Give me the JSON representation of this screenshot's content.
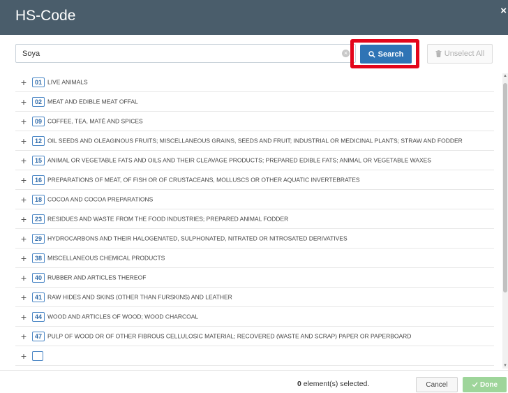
{
  "dialog": {
    "title": "HS-Code",
    "close_glyph": "×"
  },
  "search": {
    "value": "Soya",
    "placeholder": "",
    "button_label": "Search",
    "clear_glyph": "×"
  },
  "unselect_all_label": "Unselect All",
  "items": [
    {
      "code": "01",
      "description": "LIVE ANIMALS"
    },
    {
      "code": "02",
      "description": "MEAT AND EDIBLE MEAT OFFAL"
    },
    {
      "code": "09",
      "description": "COFFEE, TEA, MATÉ AND SPICES"
    },
    {
      "code": "12",
      "description": "OIL SEEDS AND OLEAGINOUS FRUITS; MISCELLANEOUS GRAINS, SEEDS AND FRUIT; INDUSTRIAL OR MEDICINAL PLANTS; STRAW AND FODDER"
    },
    {
      "code": "15",
      "description": "ANIMAL OR VEGETABLE FATS AND OILS AND THEIR CLEAVAGE PRODUCTS; PREPARED EDIBLE FATS; ANIMAL OR VEGETABLE WAXES"
    },
    {
      "code": "16",
      "description": "PREPARATIONS OF MEAT, OF FISH OR OF CRUSTACEANS, MOLLUSCS OR OTHER AQUATIC INVERTEBRATES"
    },
    {
      "code": "18",
      "description": "COCOA AND COCOA PREPARATIONS"
    },
    {
      "code": "23",
      "description": "RESIDUES AND WASTE FROM THE FOOD INDUSTRIES; PREPARED ANIMAL FODDER"
    },
    {
      "code": "29",
      "description": "HYDROCARBONS AND THEIR HALOGENATED, SULPHONATED, NITRATED OR NITROSATED DERIVATIVES"
    },
    {
      "code": "38",
      "description": "MISCELLANEOUS CHEMICAL PRODUCTS"
    },
    {
      "code": "40",
      "description": "RUBBER AND ARTICLES THEREOF"
    },
    {
      "code": "41",
      "description": "RAW HIDES AND SKINS (OTHER THAN FURSKINS) AND LEATHER"
    },
    {
      "code": "44",
      "description": "WOOD AND ARTICLES OF WOOD; WOOD CHARCOAL"
    },
    {
      "code": "47",
      "description": "PULP OF WOOD OR OF OTHER FIBROUS CELLULOSIC MATERIAL; RECOVERED (WASTE AND SCRAP) PAPER OR PAPERBOARD"
    },
    {
      "code": "",
      "description": ""
    }
  ],
  "footer": {
    "selected_count": "0",
    "selected_suffix": " element(s) selected.",
    "cancel_label": "Cancel",
    "done_label": "Done"
  },
  "colors": {
    "header_bg": "#4a5d6b",
    "search_button": "#2f74b5",
    "highlight": "#e3061b",
    "done_button": "#9ed59a"
  }
}
